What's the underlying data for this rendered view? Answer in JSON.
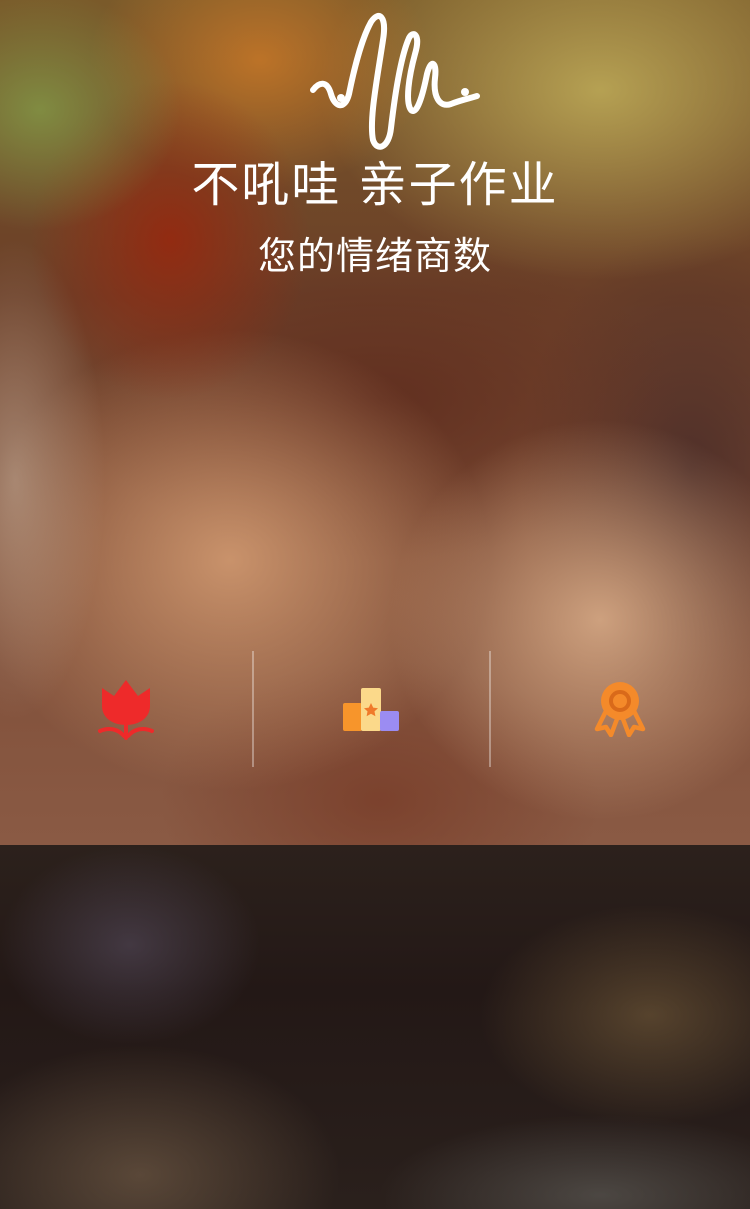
{
  "header": {
    "title": "不吼哇 亲子作业",
    "subtitle": "您的情绪商数"
  },
  "icons": [
    {
      "name": "tulip-icon",
      "color": "#ee2a2a"
    },
    {
      "name": "podium-icon",
      "colors": [
        "#f7952b",
        "#fbd98a",
        "#9b8cf2"
      ]
    },
    {
      "name": "medal-icon",
      "color": "#f48a2a"
    }
  ],
  "colors": {
    "text": "#ffffff",
    "divider": "rgba(255,255,255,0.35)"
  }
}
